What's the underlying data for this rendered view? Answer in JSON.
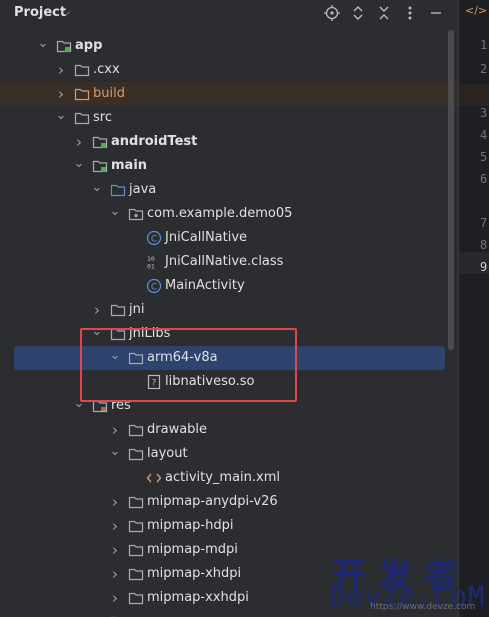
{
  "header": {
    "title": "Project",
    "icons": [
      "target-icon",
      "expand-collapse-icon",
      "collapse-all-icon",
      "more-options-icon",
      "minimize-icon"
    ]
  },
  "tree": [
    {
      "label": "app",
      "bold": true,
      "expanded": true,
      "icon": "module-folder"
    },
    {
      "label": ".cxx",
      "expanded": false,
      "icon": "folder"
    },
    {
      "label": "build",
      "expanded": false,
      "icon": "folder-orange",
      "highlight": true
    },
    {
      "label": "src",
      "expanded": true,
      "icon": "folder"
    },
    {
      "label": "androidTest",
      "bold": true,
      "expanded": false,
      "icon": "source-folder"
    },
    {
      "label": "main",
      "bold": true,
      "expanded": true,
      "icon": "source-folder"
    },
    {
      "label": "java",
      "expanded": true,
      "icon": "folder-blue"
    },
    {
      "label": "com.example.demo05",
      "expanded": true,
      "icon": "package"
    },
    {
      "label": "JniCallNative",
      "icon": "class"
    },
    {
      "label": "JniCallNative.class",
      "icon": "binary"
    },
    {
      "label": "MainActivity",
      "icon": "class"
    },
    {
      "label": "jni",
      "expanded": false,
      "icon": "folder"
    },
    {
      "label": "jniLibs",
      "expanded": true,
      "icon": "folder"
    },
    {
      "label": "arm64-v8a",
      "expanded": true,
      "icon": "folder",
      "selected": true
    },
    {
      "label": "libnativeso.so",
      "icon": "unknown-file"
    },
    {
      "label": "res",
      "expanded": true,
      "icon": "res-folder"
    },
    {
      "label": "drawable",
      "expanded": false,
      "icon": "folder"
    },
    {
      "label": "layout",
      "expanded": true,
      "icon": "folder"
    },
    {
      "label": "activity_main.xml",
      "icon": "xml"
    },
    {
      "label": "mipmap-anydpi-v26",
      "expanded": false,
      "icon": "folder"
    },
    {
      "label": "mipmap-hdpi",
      "expanded": false,
      "icon": "folder"
    },
    {
      "label": "mipmap-mdpi",
      "expanded": false,
      "icon": "folder"
    },
    {
      "label": "mipmap-xhdpi",
      "expanded": false,
      "icon": "folder"
    },
    {
      "label": "mipmap-xxhdpi",
      "expanded": false,
      "icon": "folder"
    },
    {
      "label": "",
      "expanded": false,
      "icon": "folder"
    }
  ],
  "editor": {
    "tab_glyph": "</>",
    "line_numbers": [
      "1",
      "2",
      "3",
      "4",
      "5",
      "6",
      "7",
      "8",
      "9"
    ],
    "current_line": "9"
  },
  "watermark": {
    "cn": "开发者",
    "en": "DevZe.CoM",
    "small": "https://www.devze.com"
  },
  "colors": {
    "panel": "#2b2d30",
    "selection": "#2e436e",
    "highlight_box": "#e0464a",
    "folder": "#a9acb3",
    "folder_orange": "#d69b6a",
    "folder_blue": "#5f8fd6",
    "class_icon": "#5f8fd6",
    "watermark": "#1d2a73"
  }
}
